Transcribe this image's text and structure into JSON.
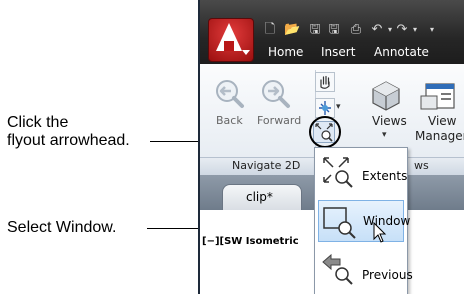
{
  "callouts": {
    "flyout_line1": "Click the",
    "flyout_line2": "flyout arrowhead.",
    "window": "Select Window."
  },
  "ribbon_tabs": [
    "Home",
    "Insert",
    "Annotate"
  ],
  "navigate_panel": {
    "back_label": "Back",
    "forward_label": "Forward",
    "title": "Navigate 2D"
  },
  "views_panel": {
    "views_label": "Views",
    "view_manager_label_1": "View",
    "view_manager_label_2": "Manager",
    "title_fragment": "ws"
  },
  "document_tab": "clip*",
  "viewport_label": "[−][SW Isometric",
  "zoom_flyout": {
    "items": [
      {
        "label": "Extents",
        "icon": "zoom-extents-icon"
      },
      {
        "label": "Window",
        "icon": "zoom-window-icon",
        "selected": true
      },
      {
        "label": "Previous",
        "icon": "zoom-previous-icon"
      }
    ]
  },
  "colors": {
    "app_red": "#b91818",
    "selection_blue": "#c7e0f8",
    "title_dark": "#262626"
  }
}
